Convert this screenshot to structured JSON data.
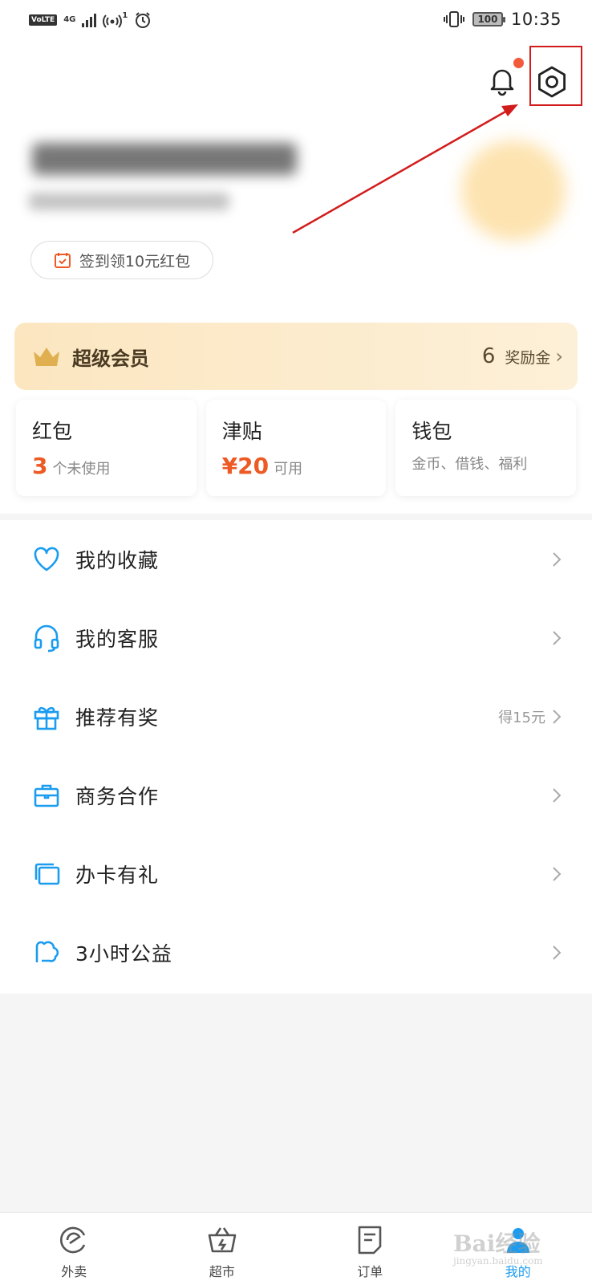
{
  "status_bar": {
    "volte": "VoLTE",
    "network": "4G",
    "signal_sub": "1",
    "battery": "100",
    "time": "10:35"
  },
  "header": {
    "notification_icon": "bell-icon",
    "settings_icon": "gear-icon"
  },
  "profile": {
    "checkin_label": "签到领10元红包"
  },
  "vip": {
    "title": "超级会员",
    "count": "6",
    "reward_label": "奖励金",
    "chevron": "›"
  },
  "cards": [
    {
      "title": "红包",
      "value": "3",
      "sub": "个未使用"
    },
    {
      "title": "津贴",
      "value": "¥20",
      "sub": "可用"
    },
    {
      "title": "钱包",
      "value": "",
      "sub": "金币、借钱、福利"
    }
  ],
  "menu": [
    {
      "label": "我的收藏",
      "extra": "",
      "icon": "heart-icon"
    },
    {
      "label": "我的客服",
      "extra": "",
      "icon": "headset-icon"
    },
    {
      "label": "推荐有奖",
      "extra": "得15元",
      "icon": "gift-icon"
    },
    {
      "label": "商务合作",
      "extra": "",
      "icon": "briefcase-icon"
    },
    {
      "label": "办卡有礼",
      "extra": "",
      "icon": "card-icon"
    },
    {
      "label": "3小时公益",
      "extra": "",
      "icon": "cloud-icon"
    }
  ],
  "tabs": [
    {
      "label": "外卖",
      "icon": "takeout-icon"
    },
    {
      "label": "超市",
      "icon": "basket-icon"
    },
    {
      "label": "订单",
      "icon": "order-icon"
    },
    {
      "label": "我的",
      "icon": "profile-icon"
    }
  ],
  "watermark": {
    "main": "Bai经验",
    "sub": "jingyan.baidu.com"
  },
  "colors": {
    "accent": "#1a9cf0",
    "price": "#ee5a24",
    "highlight": "#d21c1c",
    "vip_bg": "#fbe6c0"
  }
}
